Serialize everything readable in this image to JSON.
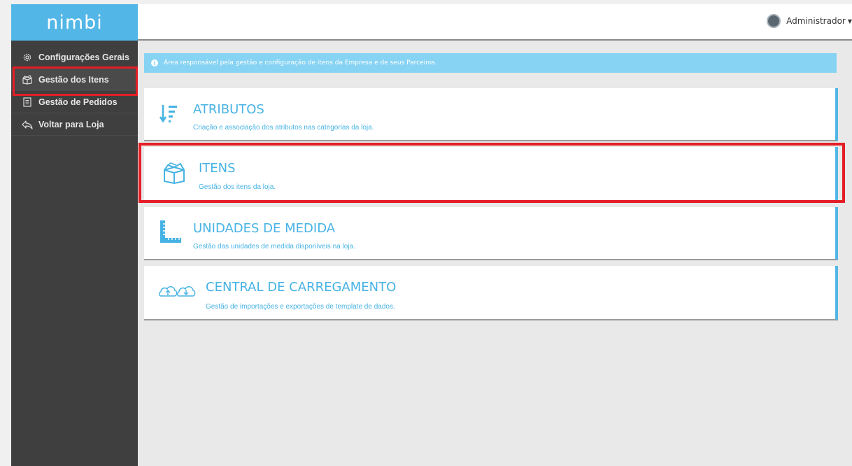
{
  "brand": {
    "logo": "nimbi",
    "accent": "#52b6e6",
    "highlight": "#e41e26"
  },
  "header": {
    "user_name": "Administrador",
    "user_menu_icon": "chevron-down-icon"
  },
  "sidebar": {
    "items": [
      {
        "label": "Configurações Gerais",
        "icon": "gear-icon"
      },
      {
        "label": "Gestão dos Itens",
        "icon": "boxes-icon",
        "active": true
      },
      {
        "label": "Gestão de Pedidos",
        "icon": "list-doc-icon"
      },
      {
        "label": "Voltar para Loja",
        "icon": "back-arrow-icon"
      }
    ]
  },
  "info_banner": {
    "text": "Área responsável pela gestão e configuração de itens da Empresa e de seus Parceiros."
  },
  "cards": [
    {
      "title": "ATRIBUTOS",
      "subtitle": "Criação e associação dos atributos nas categorias da loja.",
      "icon": "sort-desc-icon"
    },
    {
      "title": "ITENS",
      "subtitle": "Gestão dos itens da loja.",
      "icon": "boxes-icon",
      "highlighted": true
    },
    {
      "title": "UNIDADES DE MEDIDA",
      "subtitle": "Gestão das unidades de medida disponíveis na loja.",
      "icon": "ruler-icon"
    },
    {
      "title": "CENTRAL DE CARREGAMENTO",
      "subtitle": "Gestão de importações e exportações de template de dados.",
      "icon": "cloud-upload-download-icon"
    }
  ]
}
